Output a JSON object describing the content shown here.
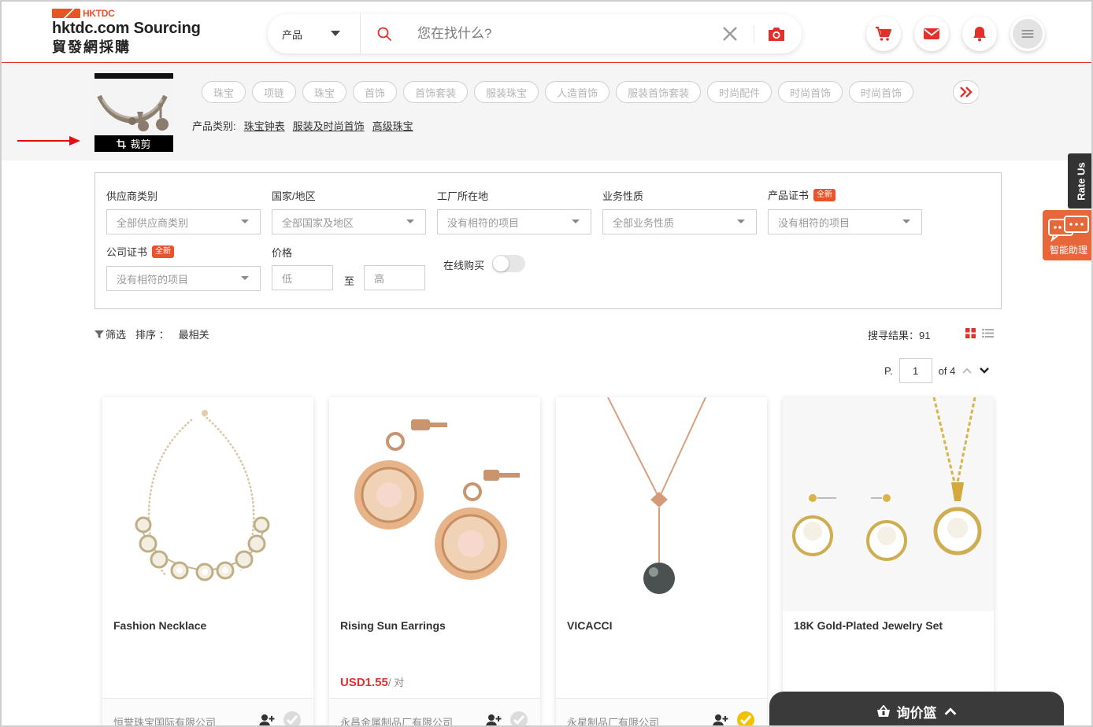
{
  "brand": {
    "hk": "HKTDC",
    "main": "hktdc.com Sourcing",
    "cn": "貿發網採購"
  },
  "search": {
    "category": "产品",
    "placeholder": "您在找什么?"
  },
  "header_icons": [
    "cart-icon",
    "mail-icon",
    "bell-icon",
    "menu-icon"
  ],
  "image_search": {
    "crop_label": "裁剪",
    "tags": [
      "珠宝",
      "项链",
      "珠宝",
      "首饰",
      "首饰套装",
      "服装珠宝",
      "人造首饰",
      "服装首饰套装",
      "时尚配件",
      "时尚首饰",
      "时尚首饰"
    ],
    "category_label": "产品类别:",
    "categories": [
      "珠宝钟表",
      "服装及时尚首饰",
      "高级珠宝"
    ]
  },
  "filters": {
    "supplier_type": {
      "label": "供应商类别",
      "value": "全部供应商类别"
    },
    "country": {
      "label": "国家/地区",
      "value": "全部国家及地区"
    },
    "factory_location": {
      "label": "工厂所在地",
      "value": "没有相符的项目"
    },
    "business_type": {
      "label": "业务性质",
      "value": "全部业务性质"
    },
    "product_cert": {
      "label": "产品证书",
      "badge": "全新",
      "value": "没有相符的项目"
    },
    "company_cert": {
      "label": "公司证书",
      "badge": "全新",
      "value": "没有相符的项目"
    },
    "price": {
      "label": "价格",
      "low": "低",
      "to": "至",
      "high": "高"
    },
    "online_buy": {
      "label": "在线购买"
    }
  },
  "sort": {
    "filter_label": "筛选",
    "sort_label": "排序 ：",
    "sort_value": "最相关",
    "results": "搜寻结果：91"
  },
  "pager": {
    "prefix": "P.",
    "page": "1",
    "of": "of 4"
  },
  "products": [
    {
      "title": "Fashion Necklace",
      "price": "",
      "unit": "",
      "company": "恒誉珠宝国际有限公司"
    },
    {
      "title": "Rising Sun Earrings",
      "price": "USD1.55",
      "unit": "/ 对",
      "company": "永昌金属制品厂有限公司"
    },
    {
      "title": "VICACCI",
      "price": "",
      "unit": "",
      "company": "永星制品厂有限公司"
    },
    {
      "title": "18K Gold-Plated Jewelry Set",
      "price": "",
      "unit": "",
      "company": ""
    }
  ],
  "widgets": {
    "rate_us": "Rate Us",
    "assistant": "智能助理",
    "basket": "询价篮"
  },
  "colors": {
    "accent": "#e2302a",
    "brand_orange": "#e8532a",
    "dark": "#3a3a3a"
  }
}
